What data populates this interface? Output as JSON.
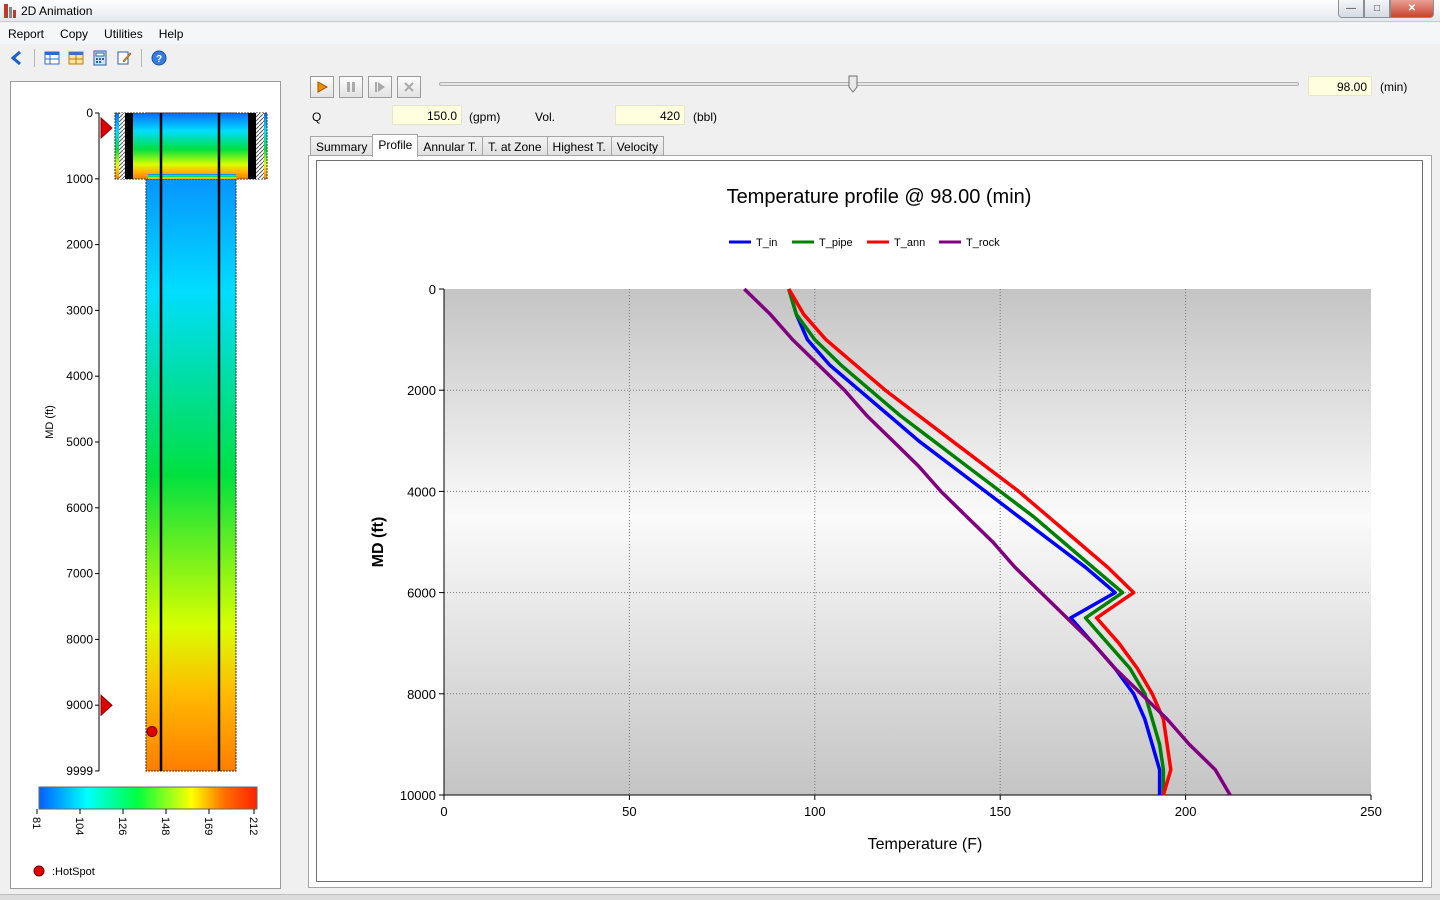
{
  "window": {
    "title": "2D Animation"
  },
  "menu": [
    "Report",
    "Copy",
    "Utilities",
    "Help"
  ],
  "toolbar_icons": [
    "back-arrow-icon",
    "table-icon",
    "grid-icon",
    "calculator-icon",
    "edit-icon",
    "help-icon"
  ],
  "controls": {
    "time_value": "98.00",
    "time_unit": "(min)",
    "time_fraction": 0.48,
    "q_label": "Q",
    "q_value": "150.0",
    "q_unit": "(gpm)",
    "vol_label": "Vol.",
    "vol_value": "420",
    "vol_unit": "(bbl)"
  },
  "tabs": [
    {
      "label": "Summary",
      "active": false
    },
    {
      "label": "Profile",
      "active": true
    },
    {
      "label": "Annular T.",
      "active": false
    },
    {
      "label": "T. at Zone",
      "active": false
    },
    {
      "label": "Highest T.",
      "active": false
    },
    {
      "label": "Velocity",
      "active": false
    }
  ],
  "wellbore": {
    "axis_label": "MD (ft)",
    "depth_ticks": [
      "0",
      "1000",
      "2000",
      "3000",
      "4000",
      "5000",
      "6000",
      "7000",
      "8000",
      "9000",
      "9999"
    ],
    "markers": [
      "0",
      "9000"
    ],
    "hotspot_md": 9400,
    "colorbar_ticks": [
      "81",
      "104",
      "126",
      "148",
      "169",
      "212"
    ],
    "colorbar_colors": [
      "#0060ff",
      "#00ffff",
      "#00ff40",
      "#ffff00",
      "#ff7000",
      "#ff2000"
    ],
    "hotspot_legend": ":HotSpot"
  },
  "chart_data": {
    "type": "line",
    "title": "Temperature profile @ 98.00 (min)",
    "xlabel": "Temperature (F)",
    "ylabel": "MD (ft)",
    "xlim": [
      0,
      250
    ],
    "ylim": [
      0,
      10000
    ],
    "y_inverted": true,
    "grid": true,
    "legend_position": "top-center",
    "x_ticks": [
      "0",
      "50",
      "100",
      "150",
      "200",
      "250"
    ],
    "y_ticks": [
      "0",
      "2000",
      "4000",
      "6000",
      "8000",
      "10000"
    ],
    "md": [
      0,
      500,
      1000,
      1500,
      2000,
      2500,
      3000,
      3500,
      4000,
      4500,
      5000,
      5500,
      6000,
      6500,
      7000,
      7500,
      8000,
      8500,
      9000,
      9500,
      10000
    ],
    "series": [
      {
        "name": "T_in",
        "color": "#0000ff",
        "values": [
          93,
          95,
          98,
          104,
          112,
          120,
          128,
          137,
          146,
          155,
          164,
          173,
          181,
          169,
          175,
          181,
          186,
          189,
          191,
          193,
          193
        ]
      },
      {
        "name": "T_pipe",
        "color": "#008000",
        "values": [
          93,
          95,
          100,
          107,
          115,
          123,
          132,
          141,
          150,
          159,
          167,
          175,
          183,
          173,
          179,
          185,
          189,
          191,
          193,
          194,
          194
        ]
      },
      {
        "name": "T_ann",
        "color": "#ff0000",
        "values": [
          93,
          97,
          103,
          111,
          119,
          128,
          137,
          146,
          155,
          163,
          171,
          179,
          186,
          176,
          182,
          187,
          191,
          194,
          195,
          196,
          194
        ]
      },
      {
        "name": "T_rock",
        "color": "#800080",
        "values": [
          81,
          88,
          94,
          101,
          108,
          114,
          121,
          128,
          134,
          141,
          148,
          154,
          161,
          168,
          175,
          181,
          188,
          195,
          201,
          208,
          212
        ]
      }
    ]
  }
}
